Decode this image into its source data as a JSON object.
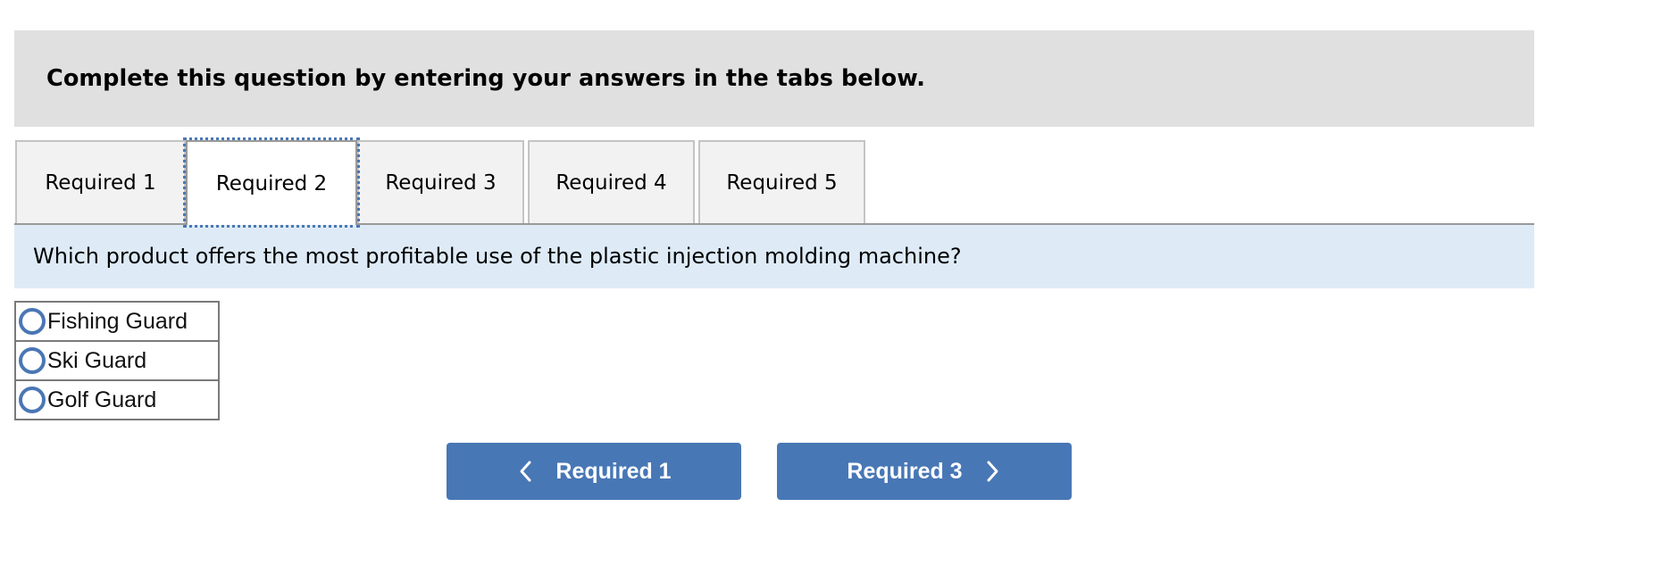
{
  "instruction": {
    "text": "Complete this question by entering your answers in the tabs below."
  },
  "tabs": [
    {
      "label": "Required 1",
      "active": false
    },
    {
      "label": "Required 2",
      "active": true
    },
    {
      "label": "Required 3",
      "active": false
    },
    {
      "label": "Required 4",
      "active": false
    },
    {
      "label": "Required 5",
      "active": false
    }
  ],
  "question": {
    "text": "Which product offers the most profitable use of the plastic injection molding machine?"
  },
  "options": [
    {
      "label": "Fishing Guard",
      "selected": false
    },
    {
      "label": "Ski Guard",
      "selected": false
    },
    {
      "label": "Golf Guard",
      "selected": false
    }
  ],
  "navigation": {
    "prev_label": "Required 1",
    "prev_icon": "chevron-left-icon",
    "next_label": "Required 3",
    "next_icon": "chevron-right-icon"
  },
  "colors": {
    "accent": "#4877b5",
    "instruction_bg": "#e0e0e0",
    "question_bg": "#deebf7",
    "tab_bg": "#f2f2f2",
    "active_tab_bg": "#ffffff"
  }
}
